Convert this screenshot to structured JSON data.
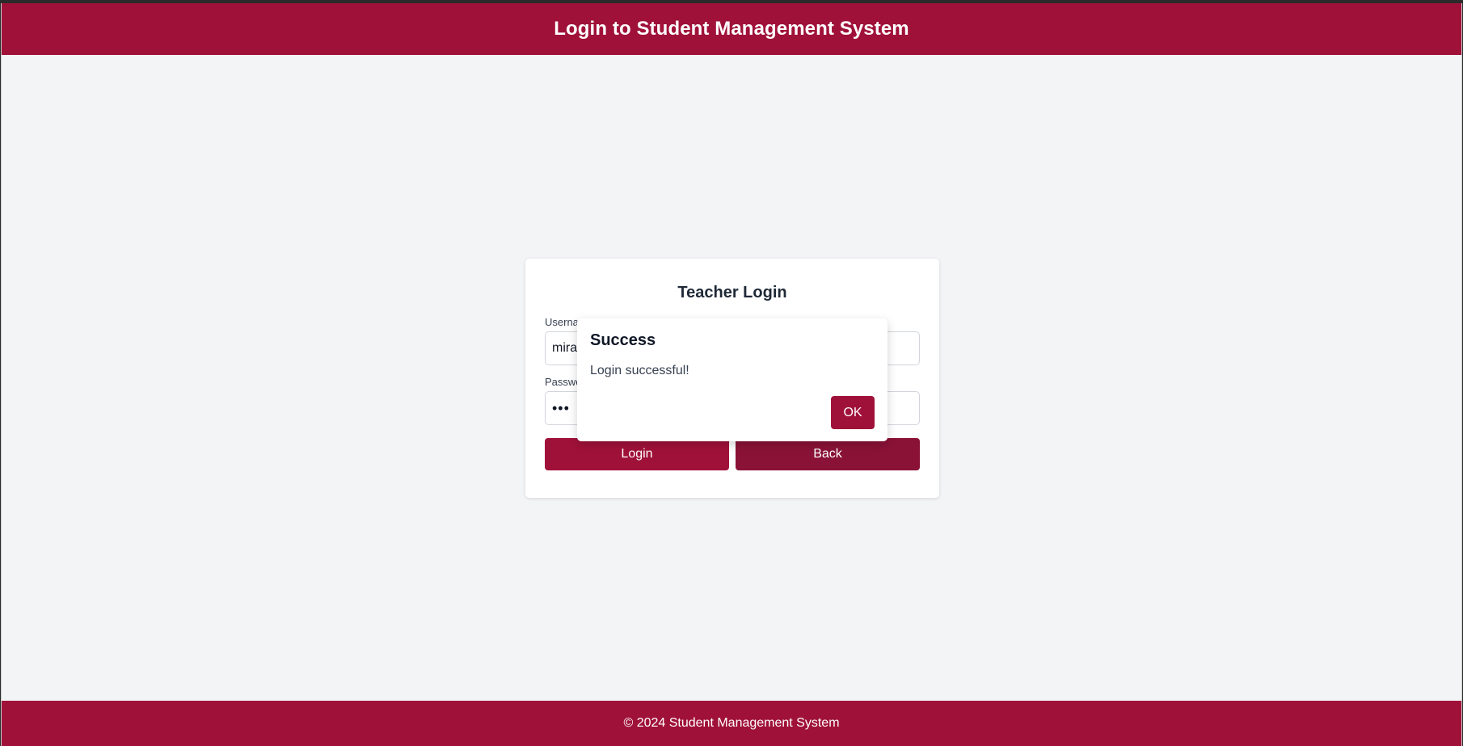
{
  "header": {
    "title": "Login to Student Management System"
  },
  "login_card": {
    "title": "Teacher Login",
    "username_label": "Username",
    "username_value": "mira",
    "password_label": "Password",
    "password_value": "•••",
    "login_button": "Login",
    "back_button": "Back"
  },
  "dialog": {
    "title": "Success",
    "message": "Login successful!",
    "ok_button": "OK"
  },
  "footer": {
    "text": "© 2024 Student Management System"
  },
  "colors": {
    "brand": "#a01139",
    "back_button": "#8a1236",
    "page_background": "#f3f4f6"
  }
}
